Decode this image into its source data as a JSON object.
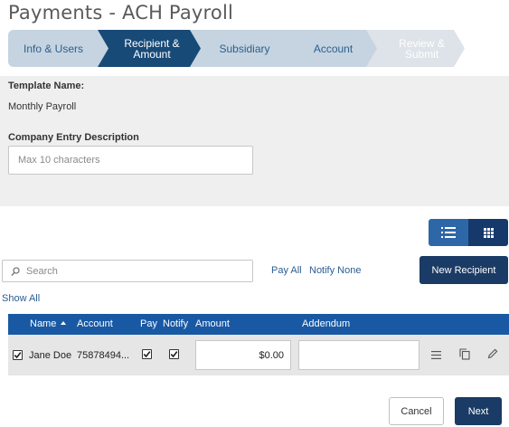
{
  "page": {
    "title": "Payments - ACH Payroll"
  },
  "stepper": {
    "steps": [
      {
        "line1": "Info & Users",
        "line2": "",
        "state": "completed"
      },
      {
        "line1": "Recipient &",
        "line2": "Amount",
        "state": "active"
      },
      {
        "line1": "Subsidiary",
        "line2": "",
        "state": "upcoming"
      },
      {
        "line1": "Account",
        "line2": "",
        "state": "upcoming"
      },
      {
        "line1": "Review &",
        "line2": "Submit",
        "state": "disabled"
      }
    ]
  },
  "form": {
    "template_name_label": "Template Name:",
    "template_name_value": "Monthly Payroll",
    "entry_desc_label": "Company Entry Description",
    "entry_desc_placeholder": "Max 10 characters",
    "entry_desc_value": ""
  },
  "view_toggle": {
    "icons": [
      "list-view-icon",
      "grid-view-icon"
    ],
    "active": "list"
  },
  "search": {
    "placeholder": "Search",
    "value": ""
  },
  "actions": {
    "pay_all": "Pay All",
    "notify_none": "Notify None",
    "new_recipient": "New Recipient",
    "show_all": "Show All"
  },
  "table": {
    "columns": {
      "name": "Name",
      "account": "Account",
      "pay": "Pay",
      "notify": "Notify",
      "amount": "Amount",
      "addendum": "Addendum"
    },
    "sort": {
      "column": "name",
      "direction": "ascending"
    },
    "rows": [
      {
        "selected": true,
        "name": "Jane Doe",
        "account": "75878494...",
        "pay": true,
        "notify": true,
        "amount": "$0.00",
        "addendum": ""
      }
    ],
    "row_action_icons": [
      "menu-icon",
      "copy-icon",
      "edit-icon"
    ]
  },
  "footer": {
    "cancel": "Cancel",
    "next": "Next"
  },
  "colors": {
    "primary_dark": "#1a3b65",
    "table_header": "#1959a4",
    "step_active": "#184a78",
    "step_inactive": "#c5d4e0",
    "link": "#2b5c94"
  }
}
